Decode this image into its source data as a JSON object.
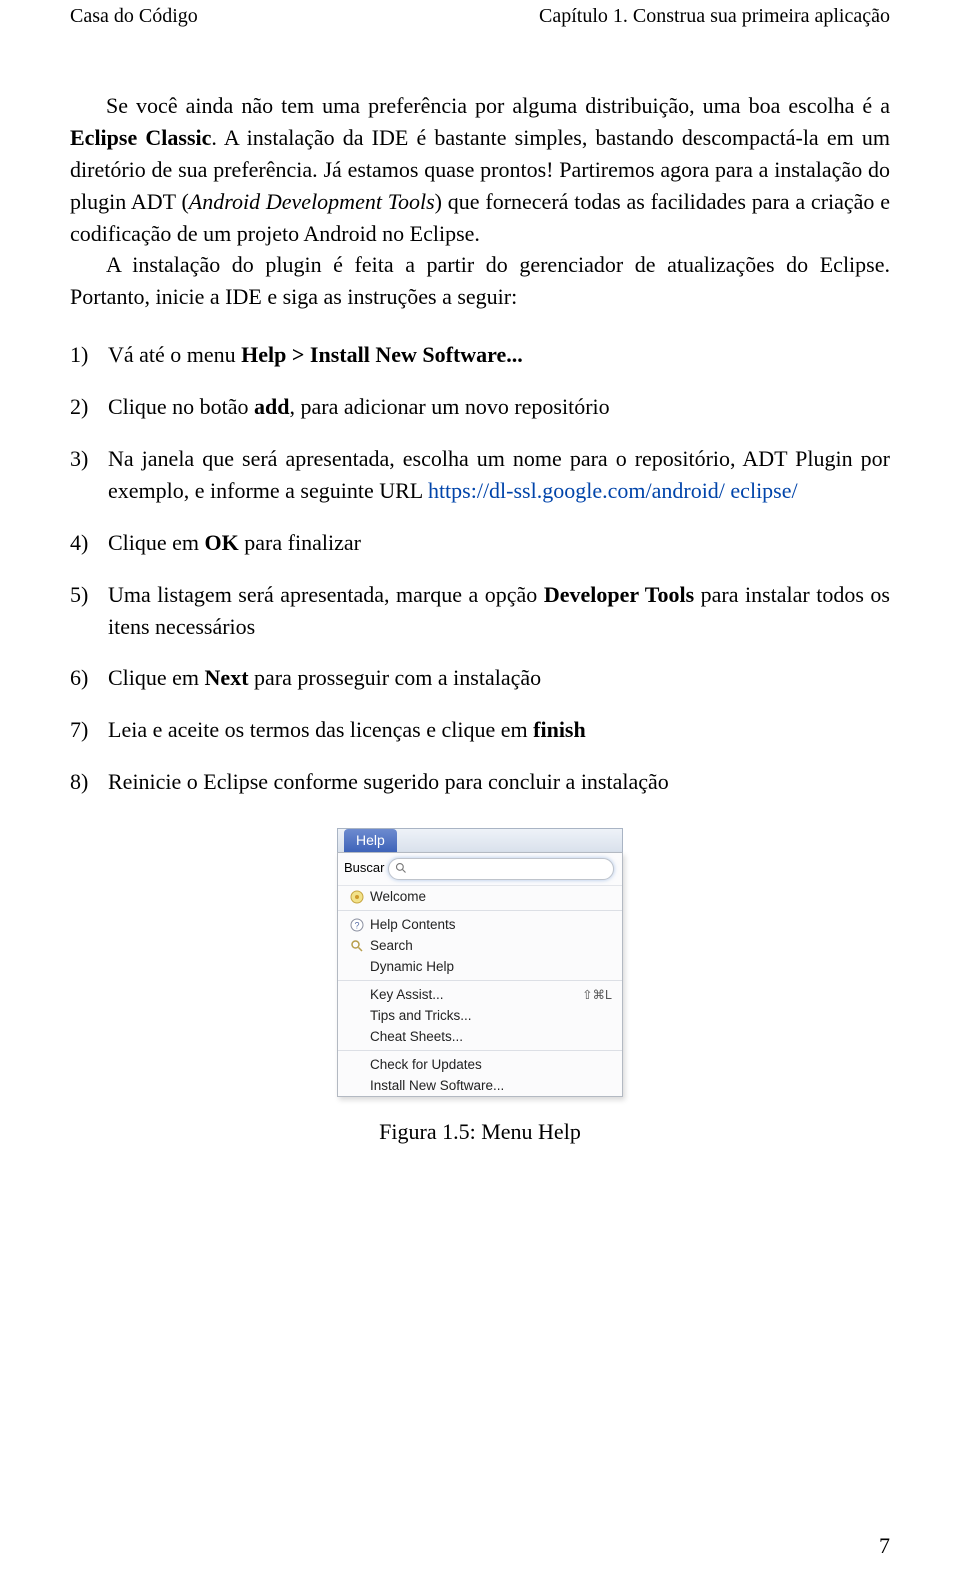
{
  "header": {
    "left": "Casa do Código",
    "right": "Capítulo 1. Construa sua primeira aplicação"
  },
  "para1": {
    "a": "Se você ainda não tem uma preferência por alguma distribuição, uma boa escolha é a ",
    "eclipse_classic": "Eclipse Classic",
    "b": ". A instalação da IDE é bastante simples, bastando descompactá-la em um diretório de sua preferência. Já estamos quase prontos! Partiremos agora para a instalação do plugin ADT (",
    "adt_italic": "Android Development Tools",
    "c": ") que fornecerá todas as facilidades para a criação e codificação de um projeto Android no Eclipse."
  },
  "para2": "A instalação do plugin é feita a partir do gerenciador de atualizações do Eclipse. Portanto, inicie a IDE e siga as instruções a seguir:",
  "steps": {
    "s1": {
      "num": "1)",
      "a": "Vá até o menu ",
      "b": "Help > Install New Software..."
    },
    "s2": {
      "num": "2)",
      "a": "Clique no botão ",
      "b": "add",
      "c": ", para adicionar um novo repositório"
    },
    "s3": {
      "num": "3)",
      "a": "Na janela que será apresentada, escolha um nome para o repositório, ADT Plugin por exemplo, e informe a seguinte URL ",
      "url1": "https://dl-ssl.google.com/android/",
      "url2": "eclipse/"
    },
    "s4": {
      "num": "4)",
      "a": "Clique em ",
      "b": "OK",
      "c": " para finalizar"
    },
    "s5": {
      "num": "5)",
      "a": "Uma listagem será apresentada, marque a opção ",
      "b": "Developer Tools",
      "c": " para instalar todos os itens necessários"
    },
    "s6": {
      "num": "6)",
      "a": "Clique em ",
      "b": "Next",
      "c": " para prosseguir com a instalação"
    },
    "s7": {
      "num": "7)",
      "a": "Leia e aceite os termos das licenças e clique em ",
      "b": "finish"
    },
    "s8": {
      "num": "8)",
      "a": "Reinicie o Eclipse conforme sugerido para concluir a instalação"
    }
  },
  "menu": {
    "menubar_label": "Help",
    "search_label": "Buscar",
    "items": {
      "welcome": "Welcome",
      "help_contents": "Help Contents",
      "search": "Search",
      "dynamic_help": "Dynamic Help",
      "key_assist": "Key Assist...",
      "key_assist_shortcut": "⇧⌘L",
      "tips": "Tips and Tricks...",
      "cheat": "Cheat Sheets...",
      "updates": "Check for Updates",
      "install": "Install New Software..."
    }
  },
  "figure_caption": "Figura 1.5: Menu Help",
  "page_number": "7"
}
